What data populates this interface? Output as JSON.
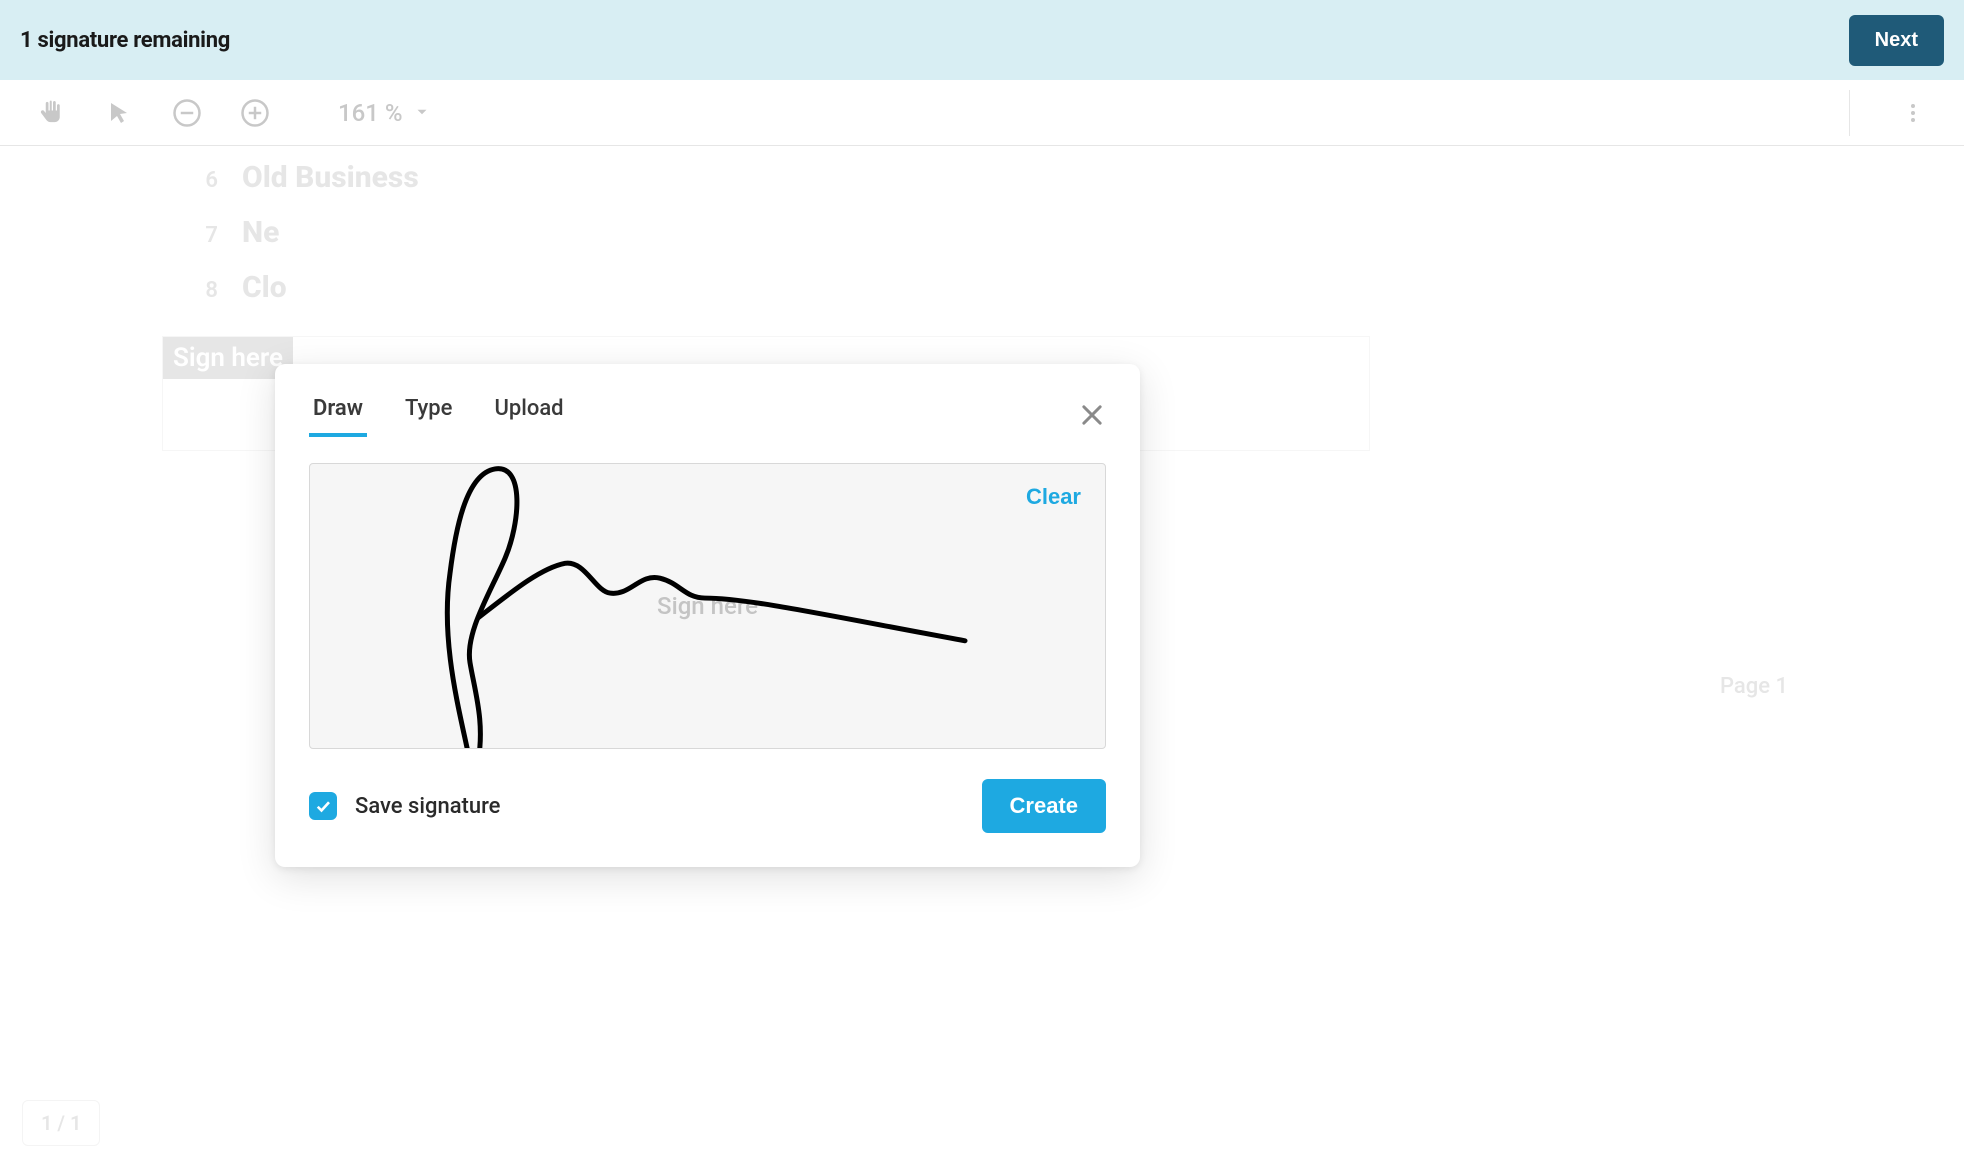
{
  "info_bar": {
    "status": "1 signature remaining",
    "next_label": "Next"
  },
  "toolbar": {
    "zoom_value": "161 %"
  },
  "document": {
    "lines": [
      {
        "num": "6",
        "text": "Old Business"
      },
      {
        "num": "7",
        "text": "Ne"
      },
      {
        "num": "8",
        "text": "Clo"
      }
    ],
    "sign_here_tag": "Sign here",
    "page_label": "Page 1",
    "page_counter": "1 / 1"
  },
  "modal": {
    "tabs": [
      {
        "label": "Draw",
        "active": true
      },
      {
        "label": "Type",
        "active": false
      },
      {
        "label": "Upload",
        "active": false
      }
    ],
    "clear_label": "Clear",
    "sign_hint": "Sign here",
    "save_signature_label": "Save signature",
    "save_signature_checked": true,
    "create_label": "Create"
  }
}
